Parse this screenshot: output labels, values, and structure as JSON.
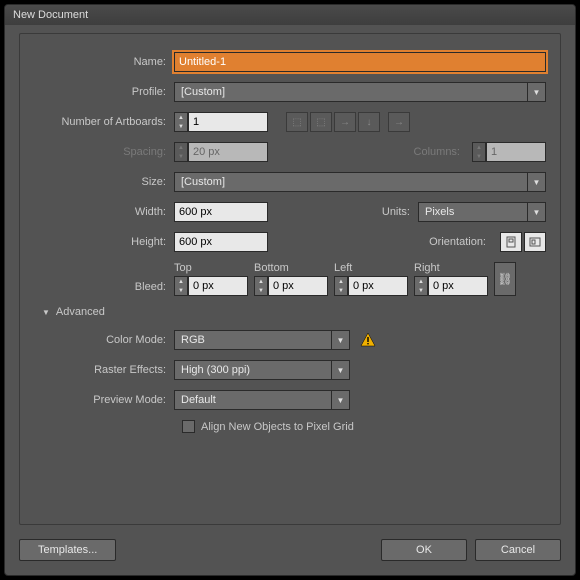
{
  "title": "New Document",
  "labels": {
    "name": "Name:",
    "profile": "Profile:",
    "artboards": "Number of Artboards:",
    "spacing": "Spacing:",
    "columns": "Columns:",
    "size": "Size:",
    "width": "Width:",
    "height": "Height:",
    "units": "Units:",
    "orientation": "Orientation:",
    "bleed": "Bleed:",
    "top": "Top",
    "bottom": "Bottom",
    "left": "Left",
    "right": "Right",
    "advanced": "Advanced",
    "colormode": "Color Mode:",
    "raster": "Raster Effects:",
    "preview": "Preview Mode:",
    "align": "Align New Objects to Pixel Grid"
  },
  "values": {
    "name": "Untitled-1",
    "profile": "[Custom]",
    "artboards": "1",
    "spacing": "20 px",
    "columns": "1",
    "size": "[Custom]",
    "width": "600 px",
    "height": "600 px",
    "units": "Pixels",
    "bleed_top": "0 px",
    "bleed_bottom": "0 px",
    "bleed_left": "0 px",
    "bleed_right": "0 px",
    "colormode": "RGB",
    "raster": "High (300 ppi)",
    "preview": "Default"
  },
  "buttons": {
    "templates": "Templates...",
    "ok": "OK",
    "cancel": "Cancel"
  }
}
